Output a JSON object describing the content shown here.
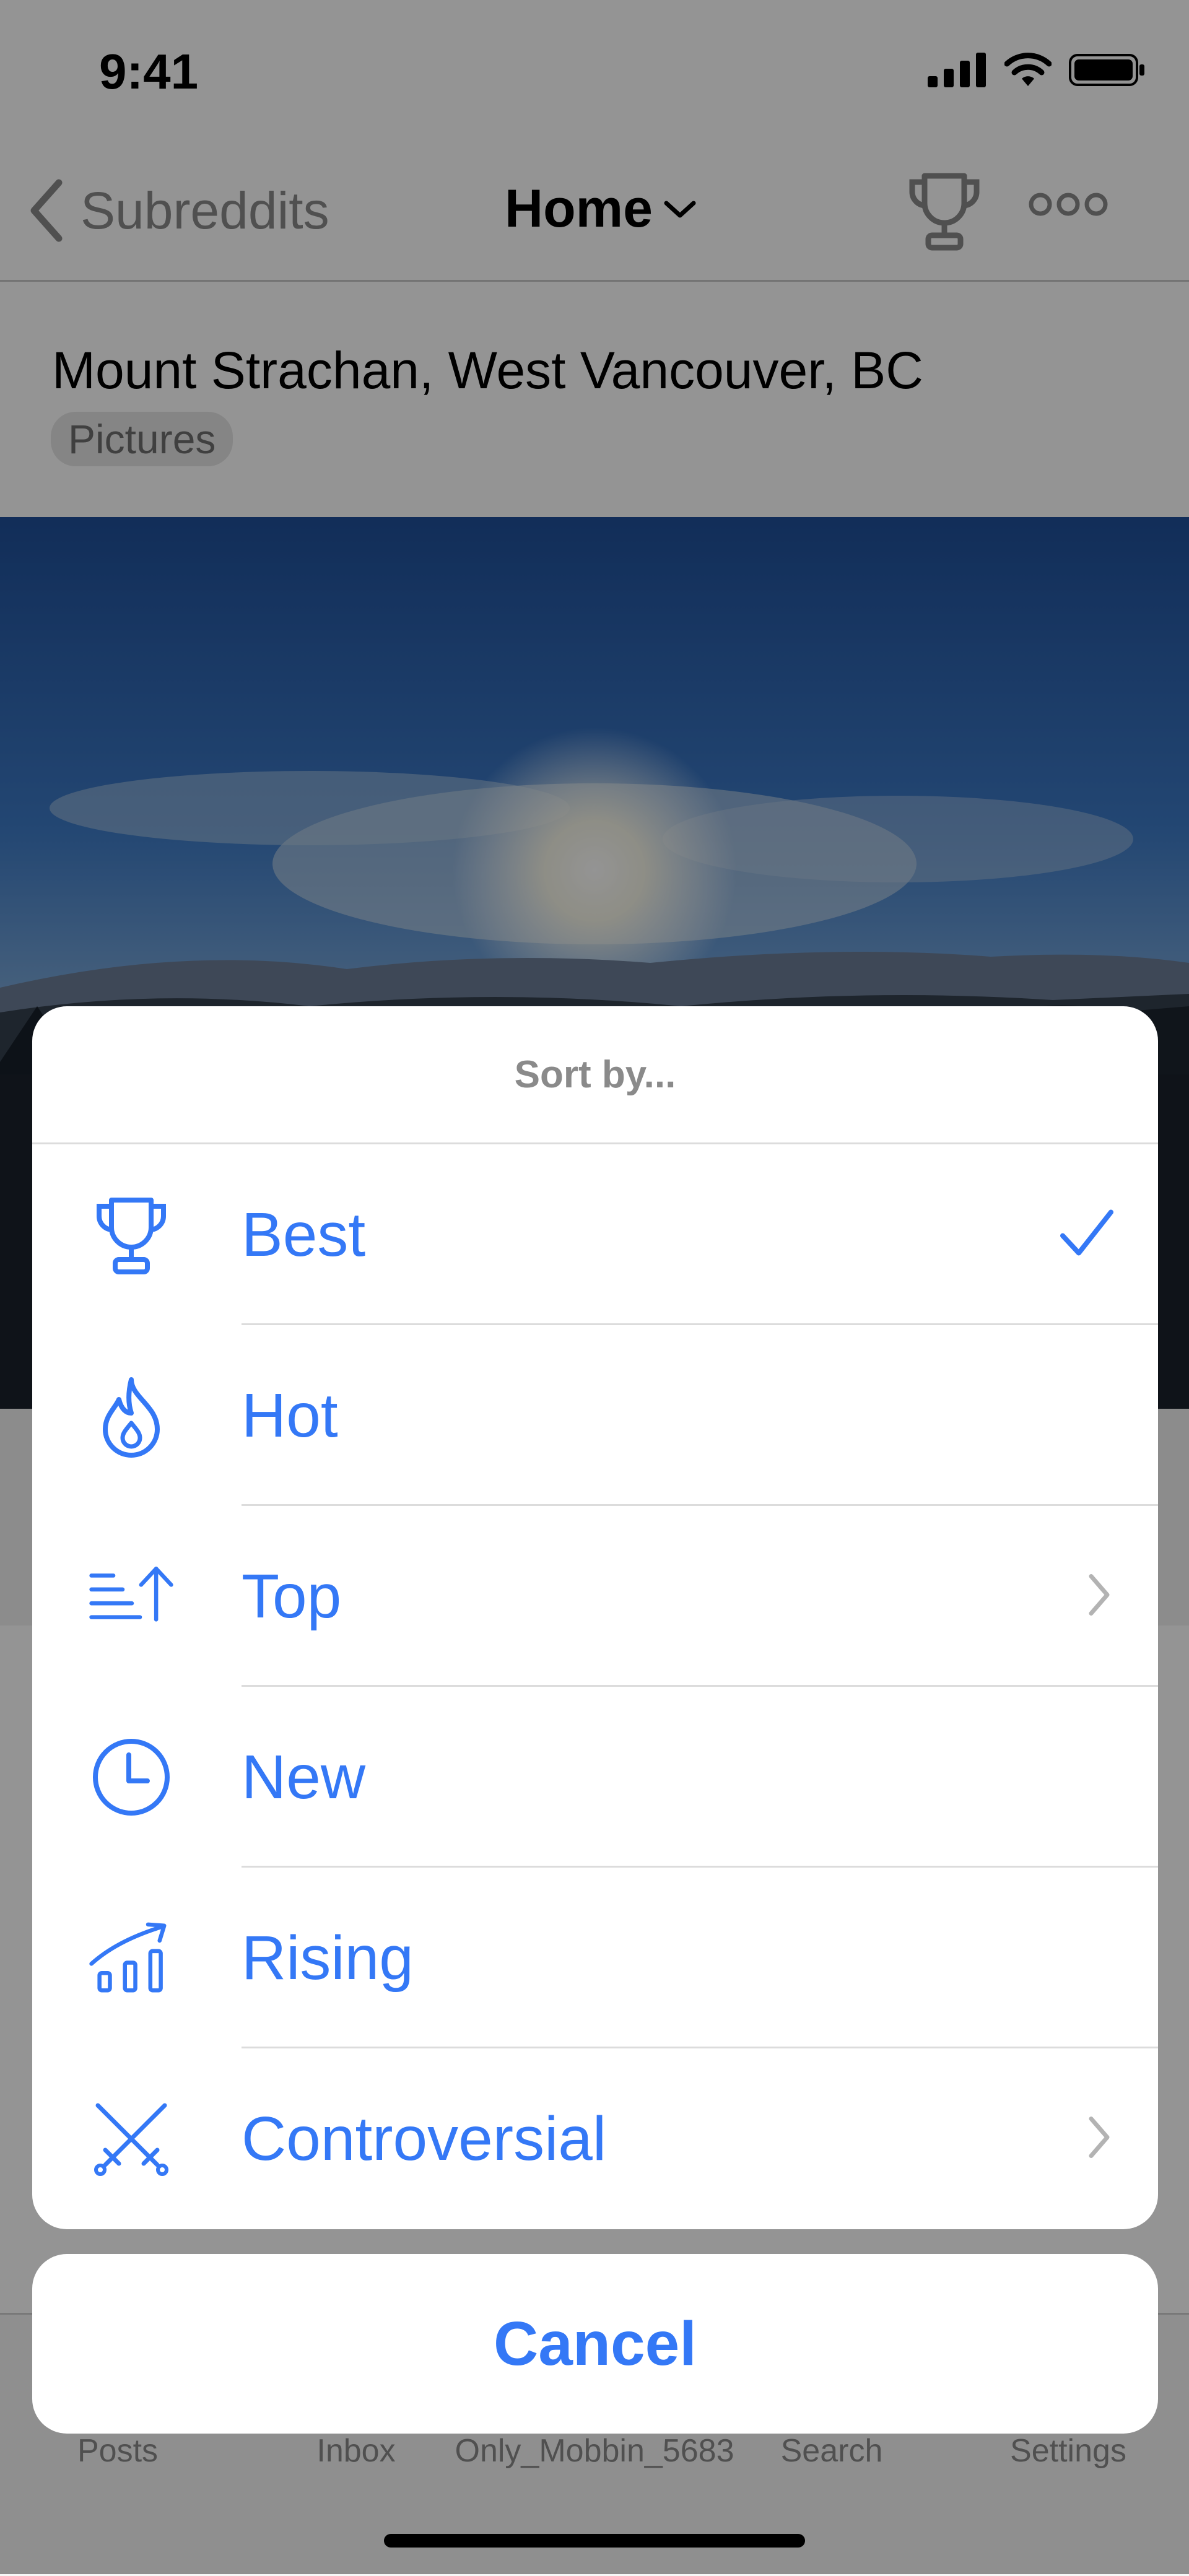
{
  "status_bar": {
    "time": "9:41"
  },
  "nav": {
    "back_label": "Subreddits",
    "title": "Home"
  },
  "post": {
    "title": "Mount Strachan, West Vancouver, BC",
    "flair": "Pictures"
  },
  "tab_bar": {
    "items": [
      {
        "label": "Posts"
      },
      {
        "label": "Inbox"
      },
      {
        "label": "Only_Mobbin_5683"
      },
      {
        "label": "Search"
      },
      {
        "label": "Settings"
      }
    ]
  },
  "sort_sheet": {
    "title": "Sort by...",
    "options": [
      {
        "label": "Best",
        "icon": "trophy-icon",
        "selected": true
      },
      {
        "label": "Hot",
        "icon": "flame-icon"
      },
      {
        "label": "Top",
        "icon": "top-sort-icon",
        "has_submenu": true
      },
      {
        "label": "New",
        "icon": "clock-icon"
      },
      {
        "label": "Rising",
        "icon": "rising-chart-icon"
      },
      {
        "label": "Controversial",
        "icon": "crossed-swords-icon",
        "has_submenu": true
      }
    ],
    "cancel_label": "Cancel"
  },
  "colors": {
    "accent": "#3478f6",
    "dim_overlay": "rgba(0,0,0,0.42)"
  }
}
